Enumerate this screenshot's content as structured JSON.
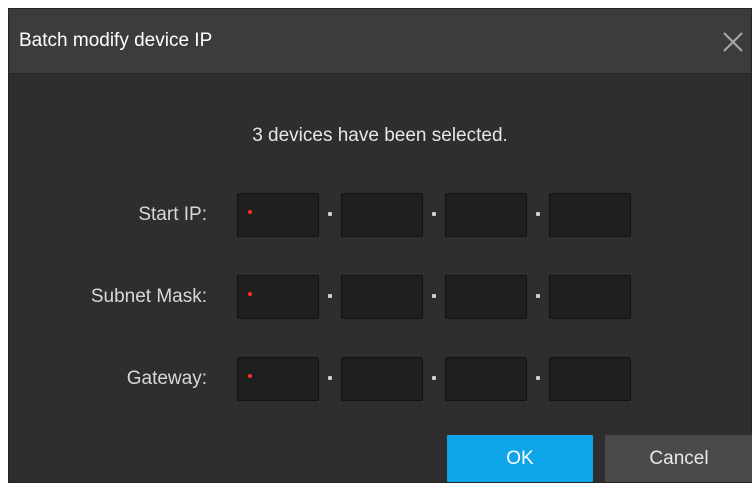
{
  "dialog": {
    "title": "Batch modify device IP",
    "message": "3 devices have been selected."
  },
  "fields": {
    "start_ip": {
      "label": "Start IP:",
      "octets": [
        "",
        "",
        "",
        ""
      ]
    },
    "subnet_mask": {
      "label": "Subnet Mask:",
      "octets": [
        "",
        "",
        "",
        ""
      ]
    },
    "gateway": {
      "label": "Gateway:",
      "octets": [
        "",
        "",
        "",
        ""
      ]
    }
  },
  "buttons": {
    "ok_label": "OK",
    "cancel_label": "Cancel"
  },
  "icons": {
    "close": "close-icon"
  },
  "colors": {
    "accent": "#0da4e8",
    "required_marker": "#ff2a2a",
    "dialog_bg": "#2e2e2e",
    "titlebar_bg": "#3c3c3c"
  }
}
